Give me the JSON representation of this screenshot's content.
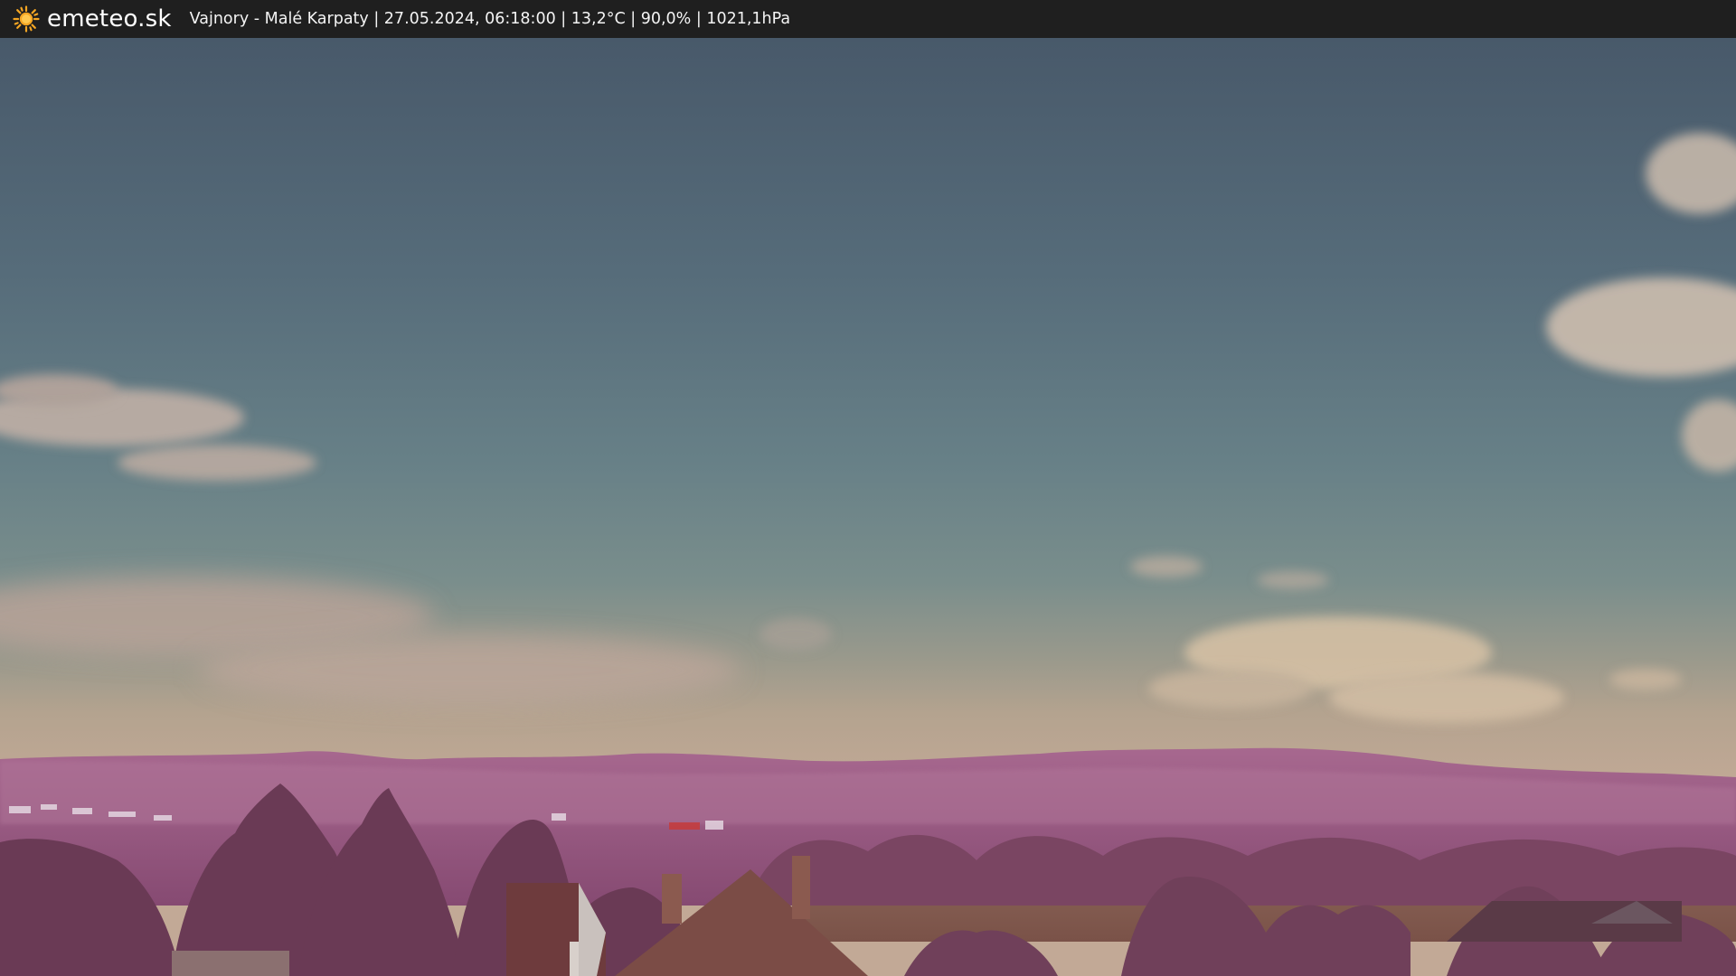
{
  "header": {
    "logo_icon": "sun-icon",
    "site_name": "emeteo.sk",
    "caption": "Vajnory - Malé Karpaty | 27.05.2024, 06:18:00 | 13,2°C | 90,0% | 1021,1hPa"
  },
  "colors": {
    "header_bg": "#1f1f1f",
    "sun": "#f5a623",
    "sky_top": "#4c5f6e",
    "sky_mid": "#6d8189",
    "sky_horizon": "#b9a493",
    "hills": "#9a6088",
    "trees": "#6e3f5a"
  }
}
